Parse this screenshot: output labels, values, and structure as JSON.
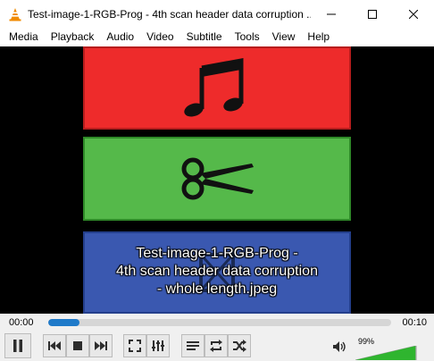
{
  "window": {
    "title": "Test-image-1-RGB-Prog - 4th scan header data corruption ...",
    "minimize_icon": "minimize-icon",
    "maximize_icon": "maximize-icon",
    "close_icon": "close-icon"
  },
  "menu": {
    "items": [
      "Media",
      "Playback",
      "Audio",
      "Video",
      "Subtitle",
      "Tools",
      "View",
      "Help"
    ]
  },
  "video": {
    "subtitle_lines": [
      "Test-image-1-RGB-Prog -",
      "4th scan header data corruption",
      "- whole length.jpeg"
    ],
    "bands": [
      {
        "color": "#ee2b2b",
        "icon": "music-note-icon"
      },
      {
        "color": "#55b94a",
        "icon": "scissors-icon"
      },
      {
        "color": "#3a58b0",
        "icon": "film-icon"
      }
    ]
  },
  "seek": {
    "elapsed": "00:00",
    "total": "00:10",
    "progress": 0.09,
    "fill_color": "#1f7ac9"
  },
  "controls": {
    "buttons": [
      "pause-icon",
      "previous-icon",
      "stop-icon",
      "next-icon",
      "fullscreen-icon",
      "extended-settings-icon",
      "playlist-icon",
      "loop-icon",
      "shuffle-icon"
    ]
  },
  "volume": {
    "label": "99%",
    "level": 0.99,
    "fill_color": "#2fb52f"
  }
}
